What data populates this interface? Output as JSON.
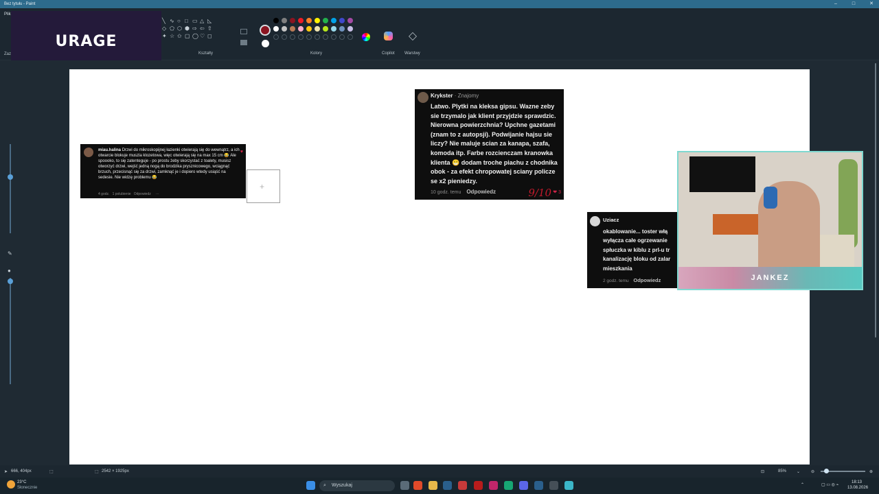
{
  "window": {
    "title": "Bez tytułu - Paint",
    "menu_file": "Plik",
    "left_cut_label": "Zaz"
  },
  "ribbon": {
    "shapes_label": "Kształty",
    "colors_label": "Kolory",
    "copilot_label": "Copilot",
    "layers_label": "Warstwy",
    "shape_glyphs": [
      "╲",
      "∿",
      "○",
      "□",
      "▭",
      "△",
      "◺",
      "◇",
      "⬠",
      "⬡",
      "⬢",
      "⇨",
      "⇦",
      "⇧",
      "✦",
      "☆",
      "✩",
      "▢",
      "◯",
      "♡",
      "◻"
    ],
    "palette": [
      "#000000",
      "#7f7f7f",
      "#8a1420",
      "#ed1c24",
      "#ff7f27",
      "#fff200",
      "#22b14c",
      "#00a2e8",
      "#3f48cc",
      "#a349a4",
      "#ffffff",
      "#c3c3c3",
      "#b97a57",
      "#ffaec9",
      "#ffc90e",
      "#efe4b0",
      "#b5e61d",
      "#99d9ea",
      "#7092be",
      "#c8bfe7",
      "",
      "",
      "",
      "",
      "",
      "",
      "",
      "",
      "",
      ""
    ],
    "primary_color": "#8a1420",
    "secondary_color": "#ffffff"
  },
  "overlay": {
    "logo_text": "URAGE"
  },
  "comment1": {
    "username": "miau.halina",
    "text": "Drzwi do mikroskopijnej łazienki otwierają się do wewnątrz, a ich otwarcie blokuje muszla klozetowa, więc otwierają się na max 15 cm 😂 Ale spoooko, to się zatenteguje - po prostu żeby skorzystać z toalety, musisz otworzyć drzwi, wejść jedną nogą do brodzika prysznicowego, wciągnąć brzuch, przecisnąć się za drzwi, zamknąć je i dopiero wtedy usiąść na sedesie. Nie widzę problemu 😂",
    "time": "4 godz.",
    "likes": "1 polubienie",
    "reply": "Odpowiedz",
    "more": "···"
  },
  "comment2": {
    "username": "Krykster",
    "relation": "· Znajomy",
    "text": "Latwo. Plytki na kleksa gipsu. Wazne zeby sie trzymalo jak klient przyjdzie sprawdzic. Nierowna powierzchnia? Upchne gazetami (znam to z autopsji). Podwijanie hajsu sie liczy? Nie maluje scian za kanapa, szafa, komoda itp. Farbe rozcienczam kranowka klienta 😁 dodam troche piachu z chodnika obok - za efekt chropowatej sciany policze se x2 pieniedzy.",
    "time": "10 godz. temu",
    "reply": "Odpowiedz",
    "likes": "❤ 3",
    "handwritten": "9/10"
  },
  "comment3": {
    "username": "Uziacz",
    "text": "okablowanie... toster włą wyłącza całe ogrzewanie spłuczka w kiblu z prl-u tr kanalizację bloku od zalar mieszkania",
    "time": "2 godz. temu",
    "reply": "Odpowiedz"
  },
  "webcam": {
    "name": "JANKEZ"
  },
  "statusbar": {
    "cursor": "666, 404px",
    "size": "2542 × 1925px",
    "zoom": "85%"
  },
  "taskbar": {
    "weather_temp": "23°C",
    "weather_desc": "Słonecznie",
    "search_placeholder": "Wyszukaj",
    "time": "18:13",
    "date": "13.08.2026"
  }
}
